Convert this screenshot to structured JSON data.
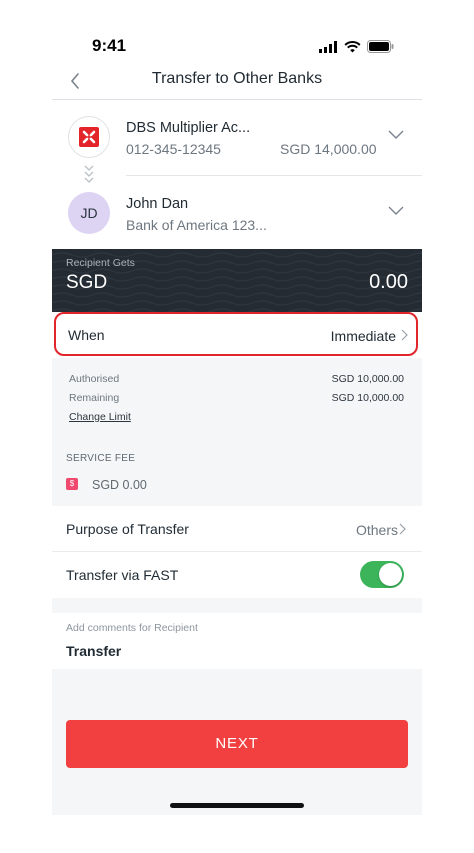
{
  "status_bar": {
    "time": "9:41"
  },
  "header": {
    "title": "Transfer to Other Banks"
  },
  "from_account": {
    "name": "DBS Multiplier Ac...",
    "number": "012-345-12345",
    "balance": "SGD 14,000.00",
    "logo_icon": "dbs-logo"
  },
  "to_account": {
    "initials": "JD",
    "name": "John Dan",
    "bank": "Bank of America 123..."
  },
  "recipient": {
    "label": "Recipient Gets",
    "currency": "SGD",
    "amount": "0.00"
  },
  "when": {
    "label": "When",
    "value": "Immediate"
  },
  "limits": {
    "authorised_label": "Authorised",
    "authorised_value": "SGD 10,000.00",
    "remaining_label": "Remaining",
    "remaining_value": "SGD 10,000.00",
    "change_limit": "Change Limit"
  },
  "service_fee": {
    "title": "SERVICE FEE",
    "icon_glyph": "$",
    "value": "SGD 0.00"
  },
  "purpose": {
    "label": "Purpose of Transfer",
    "value": "Others"
  },
  "fast": {
    "label": "Transfer via FAST",
    "enabled": true
  },
  "comments": {
    "label": "Add comments for Recipient",
    "value": "Transfer"
  },
  "next_button": {
    "label": "NEXT"
  },
  "colors": {
    "accent_red": "#f23f3f",
    "highlight_border": "#e0262a",
    "dark_band": "#242b33",
    "toggle_on": "#3cb55a",
    "avatar_bg": "#ddd3f3",
    "fee_icon": "#f0486e"
  }
}
